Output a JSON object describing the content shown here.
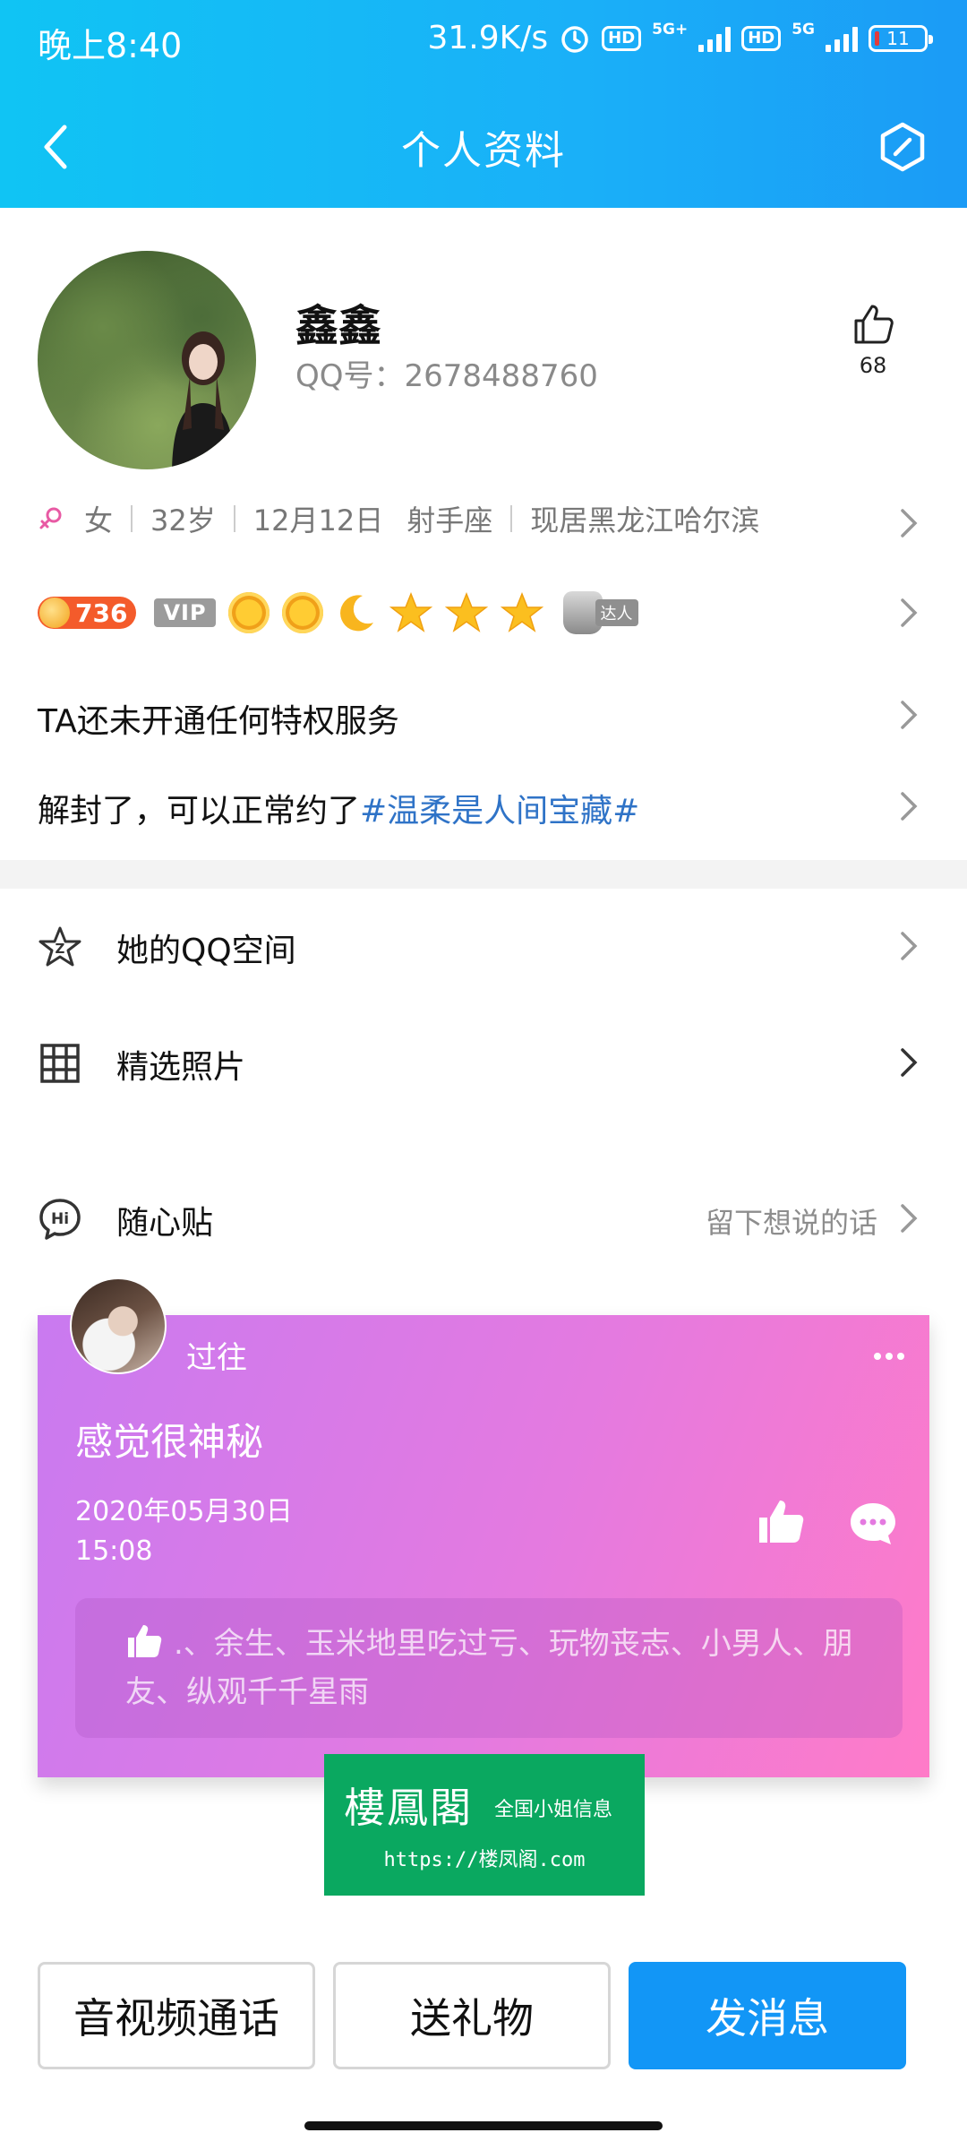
{
  "status_bar": {
    "time": "晚上8:40",
    "speed": "31.9K/s",
    "network_1": "5G+",
    "network_2": "5G",
    "hd": "HD",
    "battery": "11"
  },
  "nav": {
    "title": "个人资料"
  },
  "profile": {
    "name": "鑫鑫",
    "qq_number": "QQ号：2678488760",
    "like_count": "68",
    "gender": "女",
    "age": "32岁",
    "birthday": "12月12日",
    "zodiac": "射手座",
    "location": "现居黑龙江哈尔滨"
  },
  "badges": {
    "level": "736",
    "vip": "VIP",
    "talent": "达人"
  },
  "privilege_text": "TA还未开通任何特权服务",
  "signature": {
    "text": "解封了，可以正常约了",
    "hashtag": "#温柔是人间宝藏#"
  },
  "menu": {
    "qzone": "她的QQ空间",
    "photos": "精选照片",
    "notes": "随心贴",
    "notes_hint": "留下想说的话"
  },
  "note": {
    "author": "过往",
    "title": "感觉很神秘",
    "date": "2020年05月30日",
    "time": "15:08",
    "likers": ".、余生、玉米地里吃过亏、玩物丧志、小男人、朋友、纵观千千星雨"
  },
  "watermark": {
    "title": "樓鳳閣",
    "subtitle": "全国小姐信息",
    "url": "https://楼凤阁.com"
  },
  "actions": {
    "call": "音视频通话",
    "gift": "送礼物",
    "message": "发消息"
  },
  "colors": {
    "header_start": "#10c4f4",
    "header_end": "#1b9bf6",
    "primary_button": "#1296f6",
    "hashtag": "#2f73c7",
    "note_start": "#c97af0",
    "note_end": "#ff7bc8",
    "watermark_bg": "#0aa860"
  }
}
